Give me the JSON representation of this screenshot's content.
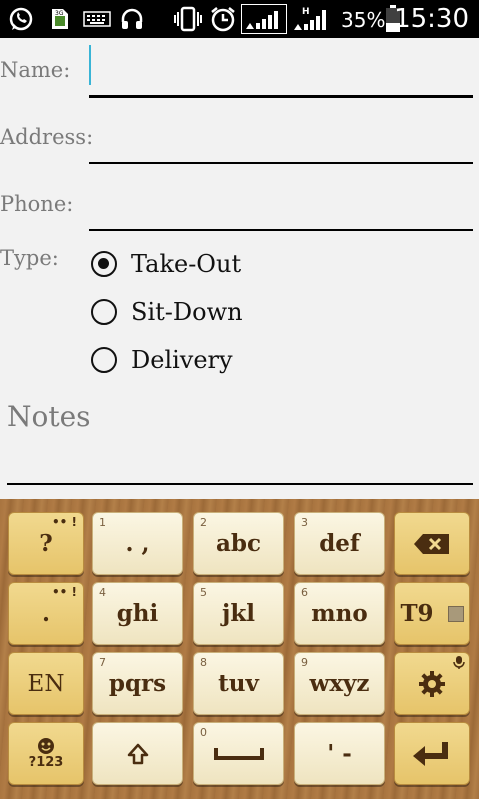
{
  "status_bar": {
    "battery_percent": "35%",
    "time": "15:30",
    "network_label": "H",
    "data_label": "3G",
    "icons": [
      "whatsapp-icon",
      "sim-3g-icon",
      "keyboard-icon",
      "headphones-icon",
      "vibrate-icon",
      "alarm-icon",
      "signal-icon",
      "signal-h-icon",
      "battery-icon"
    ]
  },
  "form": {
    "name_label": "Name:",
    "name_value": "",
    "address_label": "Address:",
    "address_value": "",
    "phone_label": "Phone:",
    "phone_value": "",
    "type_label": "Type:",
    "type_options": [
      {
        "label": "Take-Out",
        "checked": true
      },
      {
        "label": "Sit-Down",
        "checked": false
      },
      {
        "label": "Delivery",
        "checked": false
      }
    ],
    "notes_label": "Notes"
  },
  "keyboard": {
    "colors": {
      "dark_key": "#e9c96f",
      "light_key": "#f6efd6",
      "text": "#4a2d10",
      "wood": "#a8743f"
    },
    "rows": [
      {
        "left": "?",
        "left_corner": "•• !",
        "keys": [
          {
            "num": "1",
            "label": ". ,"
          },
          {
            "num": "2",
            "label": "abc"
          },
          {
            "num": "3",
            "label": "def"
          }
        ],
        "right_icon": "backspace-icon"
      },
      {
        "left": ".",
        "left_corner": "•• !",
        "keys": [
          {
            "num": "4",
            "label": "ghi"
          },
          {
            "num": "5",
            "label": "jkl"
          },
          {
            "num": "6",
            "label": "mno"
          }
        ],
        "right_label": "T9"
      },
      {
        "left": "EN",
        "keys": [
          {
            "num": "7",
            "label": "pqrs"
          },
          {
            "num": "8",
            "label": "tuv"
          },
          {
            "num": "9",
            "label": "wxyz"
          }
        ],
        "right_icon": "settings-icon"
      },
      {
        "left": "?123",
        "left_icon": "emoji-icon",
        "keys": [
          {
            "num": "",
            "label": "shift"
          },
          {
            "num": "0",
            "label": "space"
          },
          {
            "num": "",
            "label": "' -"
          }
        ],
        "right_icon": "enter-icon"
      }
    ]
  }
}
